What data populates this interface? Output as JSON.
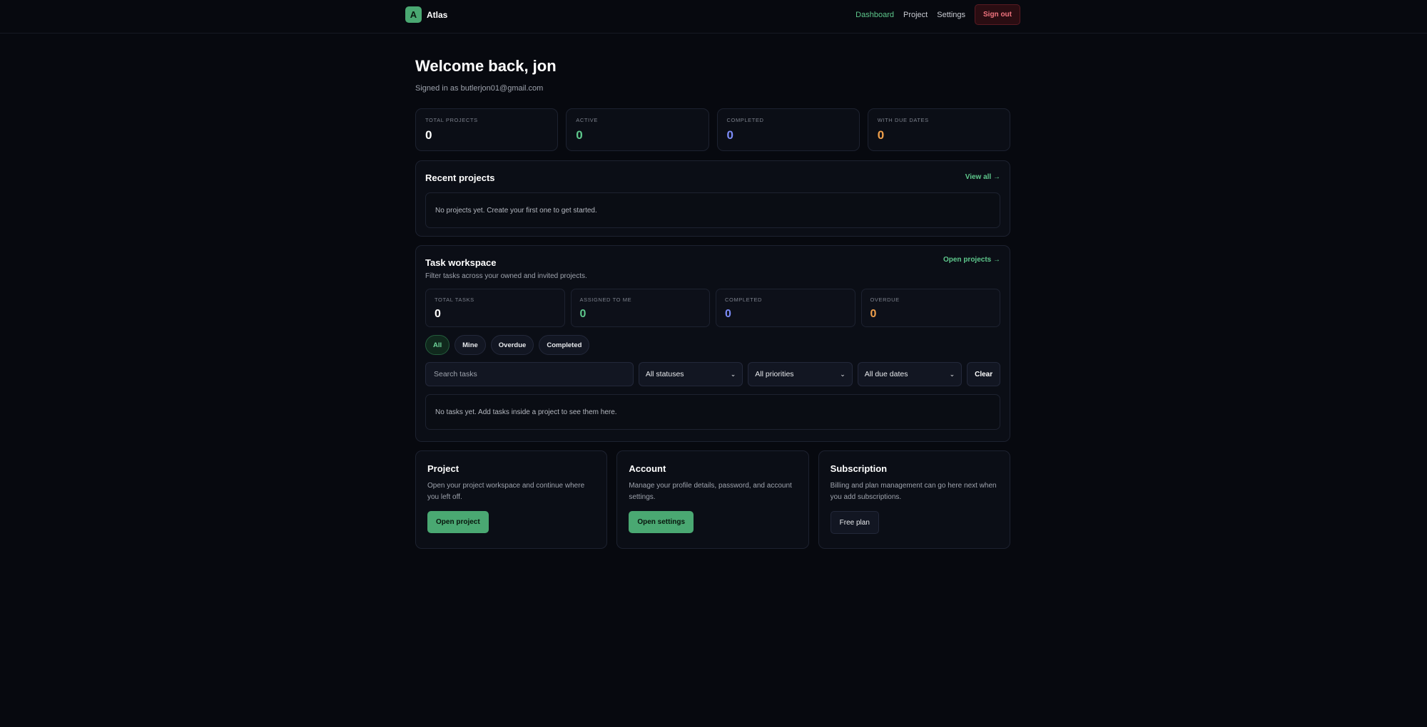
{
  "app": {
    "logo_letter": "A",
    "name": "Atlas"
  },
  "nav": {
    "dashboard": "Dashboard",
    "project": "Project",
    "settings": "Settings",
    "sign_out": "Sign out"
  },
  "header": {
    "title": "Welcome back, jon",
    "subtitle": "Signed in as butlerjon01@gmail.com"
  },
  "stats": [
    {
      "label": "TOTAL PROJECTS",
      "value": "0",
      "color": "#ffffff"
    },
    {
      "label": "ACTIVE",
      "value": "0",
      "color": "#5ec88c"
    },
    {
      "label": "COMPLETED",
      "value": "0",
      "color": "#7c8cf8"
    },
    {
      "label": "WITH DUE DATES",
      "value": "0",
      "color": "#f0a04b"
    }
  ],
  "recent": {
    "title": "Recent projects",
    "link": "View all →",
    "empty": "No projects yet. Create your first one to get started."
  },
  "workspace": {
    "title": "Task workspace",
    "link": "Open projects →",
    "subtitle": "Filter tasks across your owned and invited projects.",
    "stats": [
      {
        "label": "TOTAL TASKS",
        "value": "0",
        "color": "#ffffff"
      },
      {
        "label": "ASSIGNED TO ME",
        "value": "0",
        "color": "#5ec88c"
      },
      {
        "label": "COMPLETED",
        "value": "0",
        "color": "#7c8cf8"
      },
      {
        "label": "OVERDUE",
        "value": "0",
        "color": "#f0a04b"
      }
    ],
    "pills": [
      "All",
      "Mine",
      "Overdue",
      "Completed"
    ],
    "search_placeholder": "Search tasks",
    "status_select": "All statuses",
    "priority_select": "All priorities",
    "due_select": "All due dates",
    "clear": "Clear",
    "empty": "No tasks yet. Add tasks inside a project to see them here."
  },
  "cards": {
    "project": {
      "title": "Project",
      "text": "Open your project workspace and continue where you left off.",
      "button": "Open project"
    },
    "account": {
      "title": "Account",
      "text": "Manage your profile details, password, and account settings.",
      "button": "Open settings"
    },
    "subscription": {
      "title": "Subscription",
      "text": "Billing and plan management can go here next when you add subscriptions.",
      "button": "Free plan"
    }
  },
  "colors": {
    "accent": "#5ec88c",
    "background": "#07090f",
    "danger": "#f2747f"
  }
}
